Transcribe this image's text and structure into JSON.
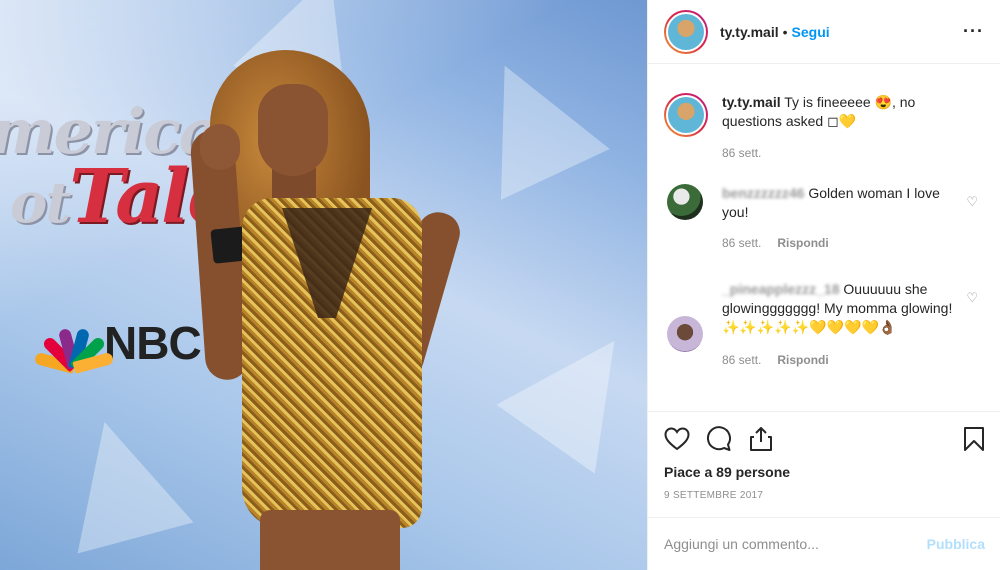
{
  "post": {
    "username": "ty.ty.mail",
    "follow_label": "Segui",
    "more_icon": "more-horizontal-icon"
  },
  "photo": {
    "background_logo_line1": "merica",
    "background_logo_line2": "ot",
    "background_logo_red": "Tale",
    "network": "NBC"
  },
  "caption": {
    "username": "ty.ty.mail",
    "text": " Ty is fineeeee 😍, no questions asked ◻💛",
    "time": "86 sett."
  },
  "comments": [
    {
      "username": "benzzzzzz46",
      "text": " Golden woman I love you!",
      "time": "86 sett.",
      "reply_label": "Rispondi"
    },
    {
      "username": "_pineapplezzz_18",
      "text": " Ouuuuuu she glowinggggggg! My momma glowing!✨✨✨✨✨💛💛💛💛👌🏾",
      "time": "86 sett.",
      "reply_label": "Rispondi"
    }
  ],
  "footer": {
    "likes": "Piace a 89 persone",
    "date": "9 SETTEMBRE 2017",
    "comment_placeholder": "Aggiungi un commento...",
    "publish_label": "Pubblica"
  },
  "colors": {
    "accent": "#0095f6",
    "publish_disabled": "#b2dffc",
    "meta": "#8e8e8e"
  }
}
